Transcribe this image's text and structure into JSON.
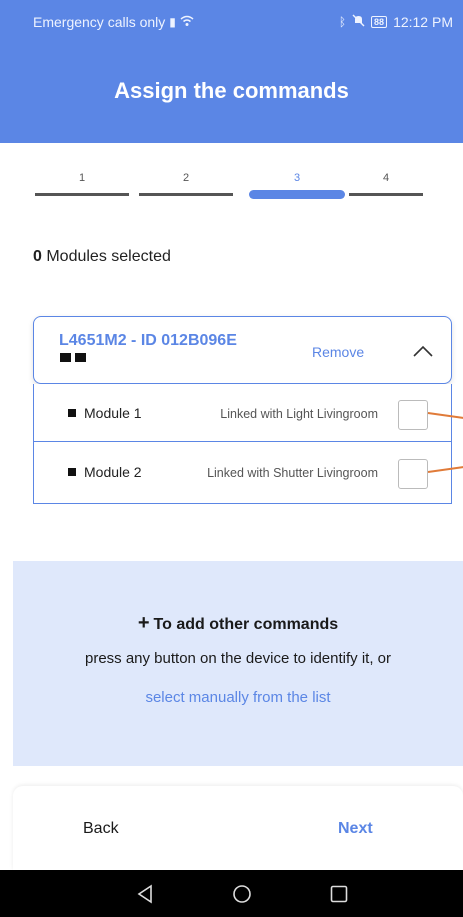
{
  "status_bar": {
    "carrier": "Emergency calls only",
    "battery": "88",
    "time": "12:12 PM",
    "icons": [
      "sim-alert-icon",
      "wifi-icon",
      "bluetooth-icon",
      "mute-icon",
      "battery-icon"
    ]
  },
  "header": {
    "title": "Assign the commands"
  },
  "stepper": {
    "steps": [
      {
        "label": "1",
        "active": false
      },
      {
        "label": "2",
        "active": false
      },
      {
        "label": "3",
        "active": true
      },
      {
        "label": "4",
        "active": false
      }
    ]
  },
  "selection": {
    "count": "0",
    "label": " Modules selected"
  },
  "device": {
    "title": "L4651M2 - ID 012B096E",
    "remove_label": "Remove",
    "modules": [
      {
        "name": "Module 1",
        "link": "Linked with Light Livingroom"
      },
      {
        "name": "Module 2",
        "link": "Linked with Shutter Livingroom"
      }
    ]
  },
  "info": {
    "title": "To add other commands",
    "text": "press any button on the device to identify it, or",
    "link": "select manually from the list"
  },
  "footer": {
    "back_label": "Back",
    "next_label": "Next"
  },
  "colors": {
    "accent": "#5b86e5",
    "panel": "#dfe8fb",
    "annotation": "#e07b39"
  }
}
